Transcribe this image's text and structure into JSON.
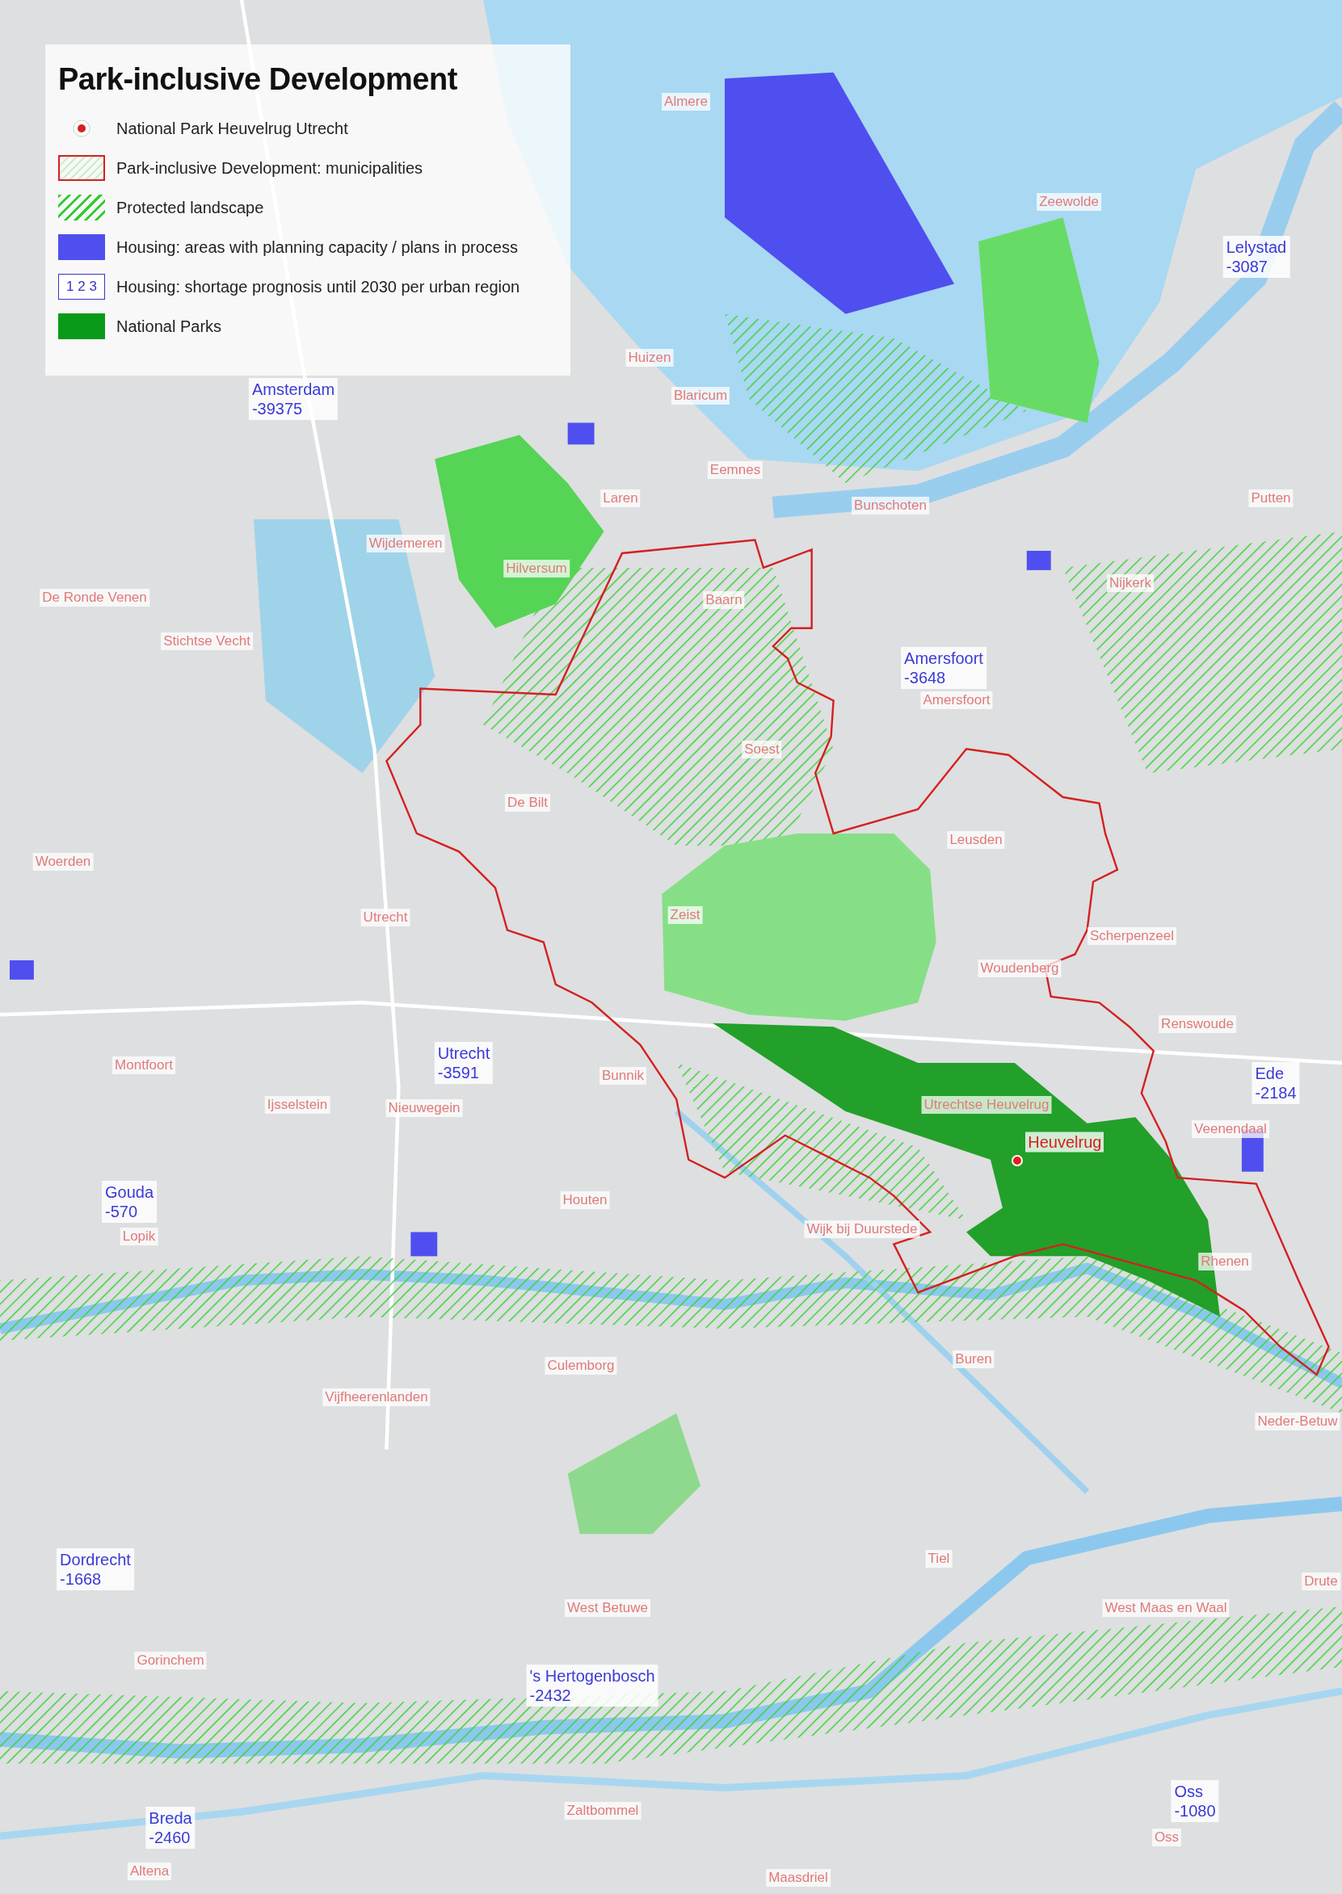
{
  "legend": {
    "title": "Park-inclusive Development",
    "items": [
      {
        "kind": "dot",
        "label": "National Park Heuvelrug Utrecht"
      },
      {
        "kind": "outline",
        "label": "Park-inclusive Development: municipalities"
      },
      {
        "kind": "hatch",
        "label": "Protected landscape"
      },
      {
        "kind": "fill",
        "label": "Housing: areas with planning capacity / plans in process"
      },
      {
        "kind": "numbers",
        "swatch_text": "1 2 3",
        "label": "Housing: shortage prognosis until 2030 per urban region"
      },
      {
        "kind": "park",
        "label": "National Parks"
      }
    ]
  },
  "map": {
    "municipalities": [
      {
        "name": "Almere"
      },
      {
        "name": "Zeewolde"
      },
      {
        "name": "Huizen"
      },
      {
        "name": "Blaricum"
      },
      {
        "name": "Eemnes"
      },
      {
        "name": "Laren"
      },
      {
        "name": "Bunschoten"
      },
      {
        "name": "Putten"
      },
      {
        "name": "Wijdemeren"
      },
      {
        "name": "Hilversum"
      },
      {
        "name": "Nijkerk"
      },
      {
        "name": "De Ronde Venen"
      },
      {
        "name": "Baarn"
      },
      {
        "name": "Stichtse Vecht"
      },
      {
        "name": "Amersfoort"
      },
      {
        "name": "Soest"
      },
      {
        "name": "De Bilt"
      },
      {
        "name": "Leusden"
      },
      {
        "name": "Woerden"
      },
      {
        "name": "Zeist"
      },
      {
        "name": "Utrecht"
      },
      {
        "name": "Scherpenzeel"
      },
      {
        "name": "Woudenberg"
      },
      {
        "name": "Renswoude"
      },
      {
        "name": "Montfoort"
      },
      {
        "name": "Bunnik"
      },
      {
        "name": "Ijsselstein"
      },
      {
        "name": "Nieuwegein"
      },
      {
        "name": "Utrechtse Heuvelrug"
      },
      {
        "name": "Veenendaal"
      },
      {
        "name": "Houten"
      },
      {
        "name": "Lopik"
      },
      {
        "name": "Wijk bij Duurstede"
      },
      {
        "name": "Rhenen"
      },
      {
        "name": "Culemborg"
      },
      {
        "name": "Buren"
      },
      {
        "name": "Vijfheerenlanden"
      },
      {
        "name": "Neder-Betuw"
      },
      {
        "name": "Tiel"
      },
      {
        "name": "West Betuwe"
      },
      {
        "name": "West Maas en Waal"
      },
      {
        "name": "Drute"
      },
      {
        "name": "Gorinchem"
      },
      {
        "name": "Zaltbommel"
      },
      {
        "name": "Maasdriel"
      },
      {
        "name": "Oss"
      },
      {
        "name": "Altena"
      }
    ],
    "regions": [
      {
        "name": "Lelystad",
        "shortage": "-3087"
      },
      {
        "name": "Amsterdam",
        "shortage": "-39375"
      },
      {
        "name": "Amersfoort",
        "shortage": "-3648"
      },
      {
        "name": "Utrecht",
        "shortage": "-3591"
      },
      {
        "name": "Ede",
        "shortage": "-2184"
      },
      {
        "name": "Gouda",
        "shortage": "-570"
      },
      {
        "name": "Dordrecht",
        "shortage": "-1668"
      },
      {
        "name": "'s Hertogenbosch",
        "shortage": "-2432"
      },
      {
        "name": "Oss",
        "shortage": "-1080"
      },
      {
        "name": "Breda",
        "shortage": "-2460"
      }
    ],
    "park_label": {
      "name": "Heuvelrug"
    }
  }
}
